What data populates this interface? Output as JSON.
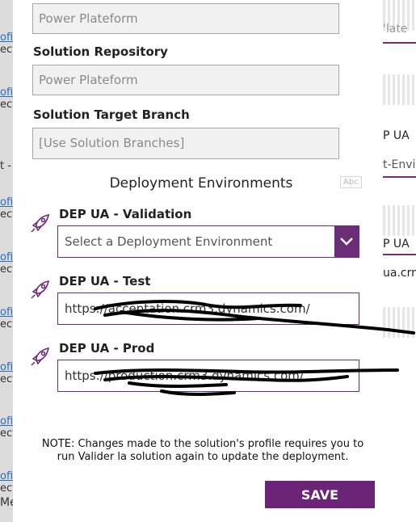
{
  "background": {
    "left_items": [
      {
        "link": "ofi",
        "text": "ect"
      },
      {
        "link": "ofi",
        "text": "ect"
      },
      {
        "link": "ofi",
        "text": "ect"
      },
      {
        "link": "ofi",
        "text": "ect"
      },
      {
        "link": "ofi",
        "text": "ect"
      },
      {
        "link": "ofi",
        "text": "ect"
      },
      {
        "link": "ofi",
        "text": "ect"
      },
      {
        "link": "ofi",
        "text": "ect"
      }
    ],
    "left_dash": "t -",
    "left_bottom": "Me",
    "right_texts": [
      "'late",
      "P UA",
      "t-Envi",
      "P UA",
      "ua.crm"
    ]
  },
  "form": {
    "top_field_value": "Power Plateform",
    "solution_repository": {
      "label": "Solution Repository",
      "value": "Power Plateform"
    },
    "solution_target_branch": {
      "label": "Solution Target Branch",
      "value": "[Use Solution Branches]"
    },
    "deployment_title": "Deployment Environments",
    "abc_badge": "Abc",
    "environments": [
      {
        "label": "DEP UA - Validation",
        "placeholder": "Select a Deployment Environment"
      },
      {
        "label": "DEP UA - Test",
        "url": "https://acceptation.crm3.dynamics.com/"
      },
      {
        "label": "DEP UA - Prod",
        "url": "https://production.crm3.dynamics.com/"
      }
    ],
    "note": "NOTE: Changes made to the solution's profile requires you to run Valider la solution again to update the deployment.",
    "save_label": "SAVE"
  },
  "colors": {
    "accent": "#6b2478",
    "field_border": "#6b2d77",
    "readonly_bg": "#f1f1f1"
  },
  "icons": {
    "environment": "rocket-icon",
    "dropdown": "chevron-down-icon"
  }
}
